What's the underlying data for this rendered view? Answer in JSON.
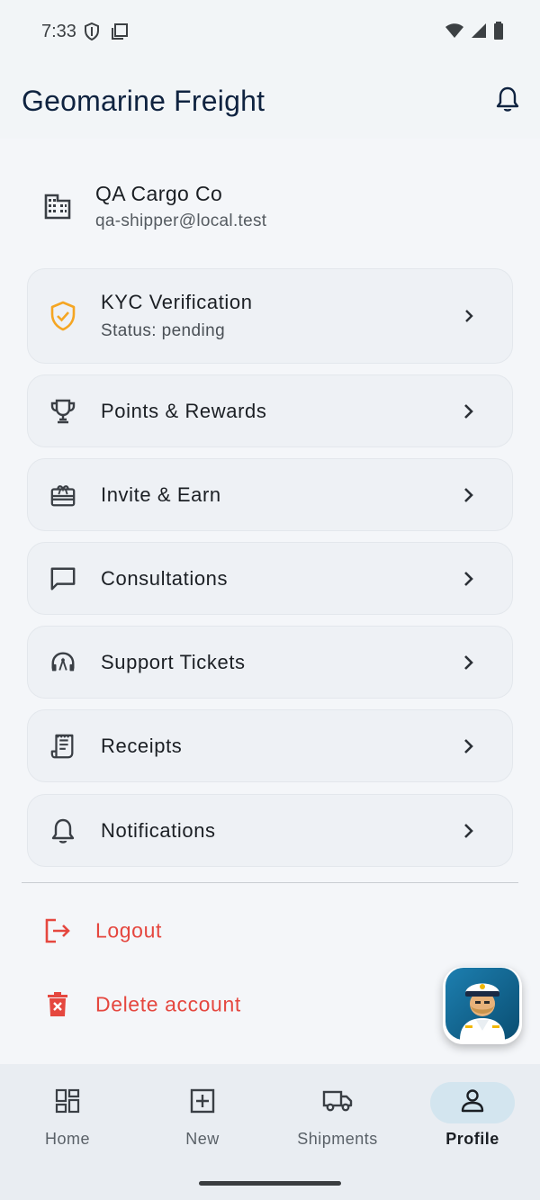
{
  "status_bar": {
    "time": "7:33",
    "left_icons": [
      "shield-icon",
      "screenshot-icon"
    ],
    "right_icons": [
      "wifi-icon",
      "signal-icon",
      "battery-icon"
    ]
  },
  "app_bar": {
    "title": "Geomarine Freight",
    "action_icon": "bell-icon"
  },
  "profile": {
    "icon": "building-icon",
    "company_name": "QA Cargo Co",
    "email": "qa-shipper@local.test"
  },
  "menu": {
    "kyc": {
      "label": "KYC Verification",
      "status": "Status: pending",
      "icon": "shield-check-icon",
      "icon_color": "#f5a623"
    },
    "rewards": {
      "label": "Points & Rewards",
      "icon": "trophy-icon"
    },
    "invite": {
      "label": "Invite & Earn",
      "icon": "gift-card-icon"
    },
    "consultations": {
      "label": "Consultations",
      "icon": "chat-icon"
    },
    "support": {
      "label": "Support Tickets",
      "icon": "headset-icon"
    },
    "receipts": {
      "label": "Receipts",
      "icon": "receipt-icon"
    },
    "notifications": {
      "label": "Notifications",
      "icon": "bell-icon"
    }
  },
  "actions": {
    "logout": {
      "label": "Logout",
      "icon": "logout-icon"
    },
    "delete": {
      "label": "Delete account",
      "icon": "trash-icon"
    },
    "color": "#e5473f"
  },
  "fab": {
    "icon": "captain-avatar-icon"
  },
  "bottom_nav": {
    "items": [
      {
        "label": "Home",
        "icon": "dashboard-icon"
      },
      {
        "label": "New",
        "icon": "add-box-icon"
      },
      {
        "label": "Shipments",
        "icon": "truck-icon"
      },
      {
        "label": "Profile",
        "icon": "person-icon"
      }
    ],
    "active": "Profile",
    "active_color": "#d3e5ef"
  }
}
